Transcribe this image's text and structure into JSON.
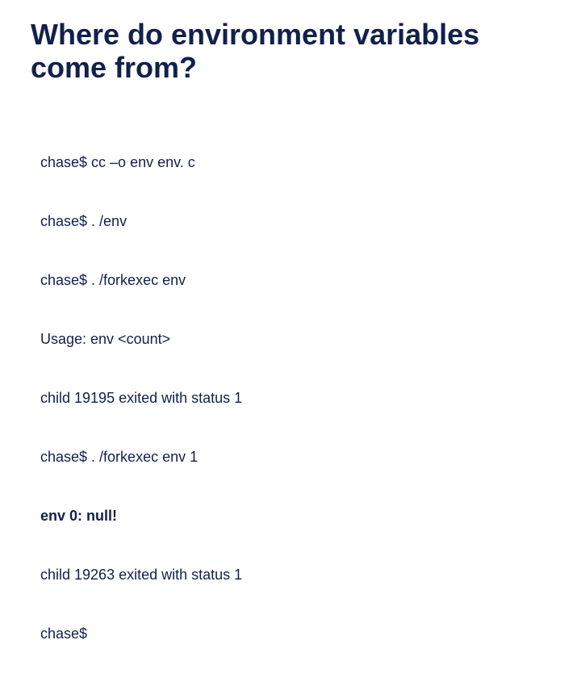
{
  "title": "Where do environment variables come from?",
  "terminal": {
    "lines": [
      {
        "text": "chase$ cc –o env env. c",
        "bold": false
      },
      {
        "text": "chase$ . /env",
        "bold": false
      },
      {
        "text": "chase$ . /forkexec env",
        "bold": false
      },
      {
        "text": "Usage: env <count>",
        "bold": false
      },
      {
        "text": "child 19195 exited with status 1",
        "bold": false
      },
      {
        "text": "chase$ . /forkexec env 1",
        "bold": false
      },
      {
        "text": "env 0: null!",
        "bold": true
      },
      {
        "text": "child 19263 exited with status 1",
        "bold": false
      },
      {
        "text": "chase$",
        "bold": false
      }
    ]
  }
}
